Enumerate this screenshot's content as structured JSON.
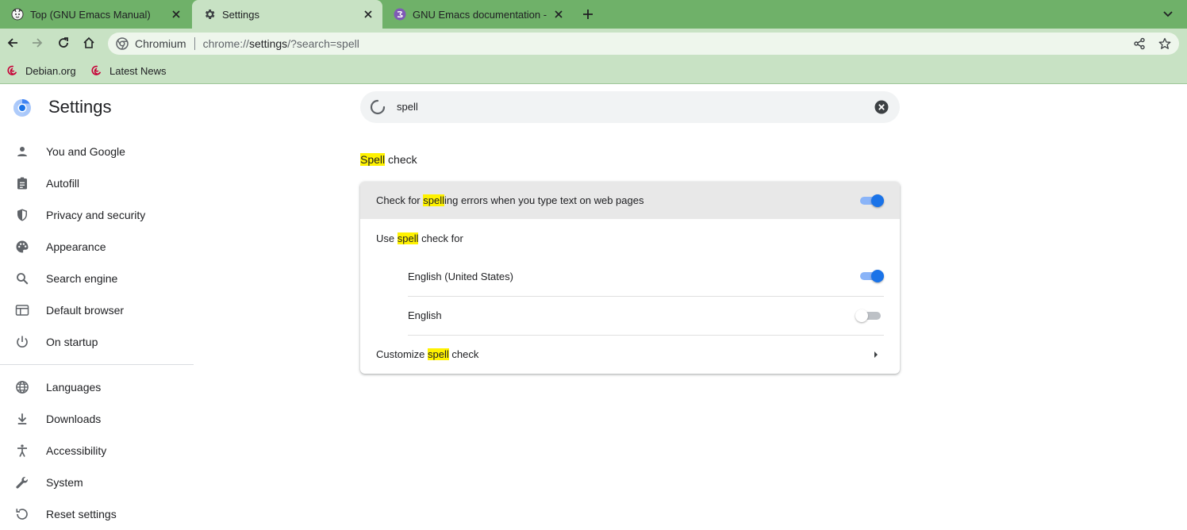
{
  "browser": {
    "tabs": [
      {
        "title": "Top (GNU Emacs Manual)",
        "icon": "gnu-head-icon",
        "active": false
      },
      {
        "title": "Settings",
        "icon": "gear-icon",
        "active": true
      },
      {
        "title": "GNU Emacs documentation -",
        "icon": "emacs-icon",
        "active": false
      }
    ],
    "omnibox": {
      "origin": "Chromium",
      "url_scheme": "chrome://",
      "url_host": "settings",
      "url_path": "/?search=spell"
    },
    "bookmarks": [
      {
        "label": "Debian.org",
        "icon": "debian-swirl-icon"
      },
      {
        "label": "Latest News",
        "icon": "debian-swirl-icon"
      }
    ],
    "colors": {
      "frame": "#6fb169",
      "toolbar": "#c8e2c4",
      "accent": "#1a73e8",
      "highlight": "#fff200"
    }
  },
  "settings": {
    "title": "Settings",
    "nav": [
      {
        "label": "You and Google",
        "icon": "person-icon"
      },
      {
        "label": "Autofill",
        "icon": "clipboard-icon"
      },
      {
        "label": "Privacy and security",
        "icon": "shield-icon"
      },
      {
        "label": "Appearance",
        "icon": "palette-icon"
      },
      {
        "label": "Search engine",
        "icon": "search-icon"
      },
      {
        "label": "Default browser",
        "icon": "browser-window-icon"
      },
      {
        "label": "On startup",
        "icon": "power-icon"
      },
      {
        "label": "Languages",
        "icon": "globe-icon"
      },
      {
        "label": "Downloads",
        "icon": "download-icon"
      },
      {
        "label": "Accessibility",
        "icon": "accessibility-icon"
      },
      {
        "label": "System",
        "icon": "wrench-icon"
      },
      {
        "label": "Reset settings",
        "icon": "reset-icon"
      }
    ],
    "search": {
      "value": "spell"
    },
    "section": {
      "title_highlight": "Spell",
      "title_rest": " check"
    },
    "rows": {
      "check_spelling": {
        "pre": "Check for ",
        "hl": "spell",
        "post": "ing errors when you type text on web pages",
        "enabled": true
      },
      "use_for": {
        "pre": "Use ",
        "hl": "spell",
        "post": " check for"
      },
      "lang_us": {
        "label": "English (United States)",
        "enabled": true
      },
      "lang_en": {
        "label": "English",
        "enabled": false
      },
      "customize": {
        "pre": "Customize ",
        "hl": "spell",
        "post": " check"
      }
    }
  }
}
